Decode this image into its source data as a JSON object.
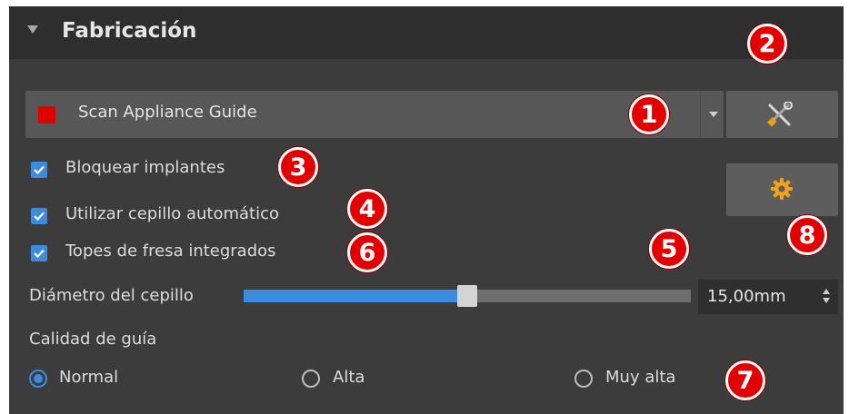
{
  "panel": {
    "title": "Fabricación"
  },
  "guide_dropdown": {
    "selected": "Scan Appliance Guide",
    "swatch_color": "#e00000"
  },
  "tools_button": {
    "icon": "tools-icon"
  },
  "settings_button": {
    "icon": "gear-icon"
  },
  "checkboxes": [
    {
      "label": "Bloquear implantes",
      "checked": true
    },
    {
      "label": "Utilizar cepillo automático",
      "checked": true
    },
    {
      "label": "Topes de fresa integrados",
      "checked": true
    }
  ],
  "brush": {
    "label": "Diámetro del cepillo",
    "value": "15,00mm",
    "fill_fraction": 0.5
  },
  "quality": {
    "label": "Calidad de guía",
    "options": [
      {
        "label": "Normal",
        "selected": true
      },
      {
        "label": "Alta",
        "selected": false
      },
      {
        "label": "Muy alta",
        "selected": false
      }
    ]
  },
  "callouts": [
    "1",
    "2",
    "3",
    "4",
    "5",
    "6",
    "7",
    "8"
  ],
  "colors": {
    "accent": "#3b8bdf",
    "callout": "#e30000",
    "panel_bg": "#3c3c3c",
    "header_bg": "#2e2e2e"
  }
}
